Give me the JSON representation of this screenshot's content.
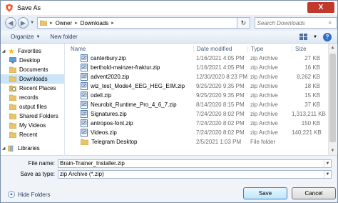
{
  "window": {
    "title": "Save As",
    "close_label": "X"
  },
  "address": {
    "segments": [
      "Owner",
      "Downloads"
    ],
    "search_placeholder": "Search Downloads"
  },
  "toolbar": {
    "organize_label": "Organize",
    "new_folder_label": "New folder"
  },
  "nav": {
    "items": [
      {
        "label": "Favorites",
        "icon": "star-icon"
      },
      {
        "label": "Desktop",
        "icon": "desktop-icon"
      },
      {
        "label": "Documents",
        "icon": "folder-icon"
      },
      {
        "label": "Downloads",
        "icon": "folder-icon",
        "selected": true
      },
      {
        "label": "Recent Places",
        "icon": "recent-places-icon"
      },
      {
        "label": "records",
        "icon": "folder-icon"
      },
      {
        "label": "output files",
        "icon": "folder-icon"
      },
      {
        "label": "Shared Folders",
        "icon": "folder-icon"
      },
      {
        "label": "My Videos",
        "icon": "folder-icon"
      },
      {
        "label": "Recent",
        "icon": "folder-icon"
      },
      {
        "label": "Libraries",
        "icon": "library-icon"
      }
    ]
  },
  "columns": {
    "name": "Name",
    "date": "Date modified",
    "type": "Type",
    "size": "Size"
  },
  "files": [
    {
      "name": "canterbury.zip",
      "date": "1/16/2021 4:05 PM",
      "type": "zip Archive",
      "size": "27 KB",
      "icon": "zip"
    },
    {
      "name": "berthold-mainzer-fraktur.zip",
      "date": "1/16/2021 4:05 PM",
      "type": "zip Archive",
      "size": "16 KB",
      "icon": "zip"
    },
    {
      "name": "advent2020.zip",
      "date": "12/30/2020 8:23 PM",
      "type": "zip Archive",
      "size": "8,262 KB",
      "icon": "zip"
    },
    {
      "name": "wiz_test_Mode4_EEG_HEG_EIM.zip",
      "date": "9/25/2020 9:35 PM",
      "type": "zip Archive",
      "size": "18 KB",
      "icon": "zip"
    },
    {
      "name": "odell.zip",
      "date": "9/25/2020 9:35 PM",
      "type": "zip Archive",
      "size": "15 KB",
      "icon": "zip"
    },
    {
      "name": "Neurobit_Runtime_Pro_4_6_7.zip",
      "date": "8/14/2020 8:15 PM",
      "type": "zip Archive",
      "size": "37 KB",
      "icon": "zip"
    },
    {
      "name": "Signatures.zip",
      "date": "7/24/2020 8:02 PM",
      "type": "zip Archive",
      "size": "1,313,211 KB",
      "icon": "zip"
    },
    {
      "name": "antropos-font.zip",
      "date": "7/24/2020 8:02 PM",
      "type": "zip Archive",
      "size": "150 KB",
      "icon": "zip"
    },
    {
      "name": "Videos.zip",
      "date": "7/24/2020 8:02 PM",
      "type": "zip Archive",
      "size": "140,221 KB",
      "icon": "zip"
    },
    {
      "name": "Telegram Desktop",
      "date": "2/5/2021 1:03 PM",
      "type": "File folder",
      "size": "",
      "icon": "folder"
    }
  ],
  "form": {
    "file_name_label": "File name:",
    "file_name_value": "Brain-Trainer_Installer.zip",
    "save_type_label": "Save as type:",
    "save_type_value": "zip Archive (*.zip)"
  },
  "footer": {
    "hide_folders_label": "Hide Folders",
    "save_label": "Save",
    "cancel_label": "Cancel"
  },
  "colors": {
    "close_button": "#c0392b",
    "selection": "#cce4f7",
    "accent": "#2f6fc4"
  }
}
